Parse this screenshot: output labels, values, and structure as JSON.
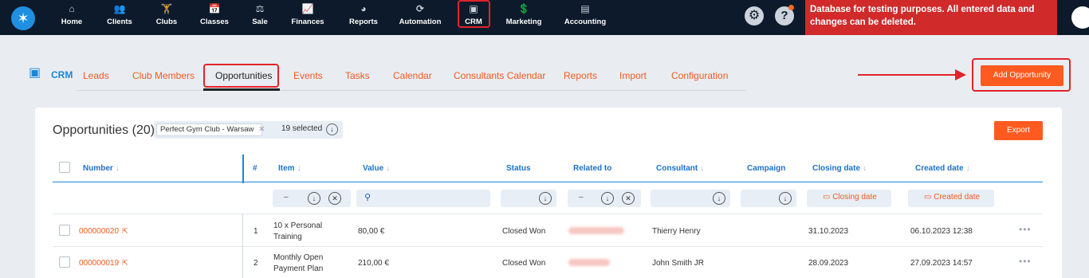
{
  "topnav": {
    "items": [
      {
        "label": "Home",
        "icon": "home-icon",
        "glyph": "⌂"
      },
      {
        "label": "Clients",
        "icon": "clients-icon",
        "glyph": "👥"
      },
      {
        "label": "Clubs",
        "icon": "clubs-icon",
        "glyph": "🏋"
      },
      {
        "label": "Classes",
        "icon": "classes-icon",
        "glyph": "📅"
      },
      {
        "label": "Sale",
        "icon": "sale-icon",
        "glyph": "⚖"
      },
      {
        "label": "Finances",
        "icon": "finances-icon",
        "glyph": "📈"
      },
      {
        "label": "Reports",
        "icon": "reports-icon",
        "glyph": "◕"
      },
      {
        "label": "Automation",
        "icon": "automation-icon",
        "glyph": "⟳"
      },
      {
        "label": "CRM",
        "icon": "crm-icon",
        "glyph": "▣"
      },
      {
        "label": "Marketing",
        "icon": "marketing-icon",
        "glyph": "💲"
      },
      {
        "label": "Accounting",
        "icon": "accounting-icon",
        "glyph": "▤"
      }
    ],
    "banner": "Database for testing purposes. All entered data and changes can be deleted."
  },
  "crm": {
    "title": "CRM",
    "tabs": [
      "Leads",
      "Club Members",
      "Opportunities",
      "Events",
      "Tasks",
      "Calendar",
      "Consultants Calendar",
      "Reports",
      "Import",
      "Configuration"
    ],
    "add_button": "Add Opportunity"
  },
  "list": {
    "title": "Opportunities (20)",
    "filter_club": "Perfect Gym Club - Warsaw",
    "filter_selected": "19 selected",
    "export": "Export",
    "headers": {
      "number": "Number",
      "hash": "#",
      "item": "Item",
      "value": "Value",
      "status": "Status",
      "related": "Related to",
      "consultant": "Consultant",
      "campaign": "Campaign",
      "closing": "Closing date",
      "created": "Created date"
    },
    "filters": {
      "closing_placeholder": "Closing date",
      "created_placeholder": "Created date"
    },
    "rows": [
      {
        "number": "000000020",
        "index": "1",
        "item_line1": "10 x Personal",
        "item_line2": "Training",
        "value": "80,00 €",
        "status": "Closed Won",
        "consultant": "Thierry Henry",
        "closing": "31.10.2023",
        "created": "06.10.2023 12:38"
      },
      {
        "number": "000000019",
        "index": "2",
        "item_line1": "Monthly Open",
        "item_line2": "Payment Plan",
        "value": "210,00 €",
        "status": "Closed Won",
        "consultant": "John Smith JR",
        "closing": "28.09.2023",
        "created": "27.09.2023 14:57"
      }
    ]
  },
  "colors": {
    "accent": "#f05a22",
    "brand_blue": "#1a86d9",
    "topbar": "#0d1a2b",
    "banner": "#d02a2a"
  }
}
